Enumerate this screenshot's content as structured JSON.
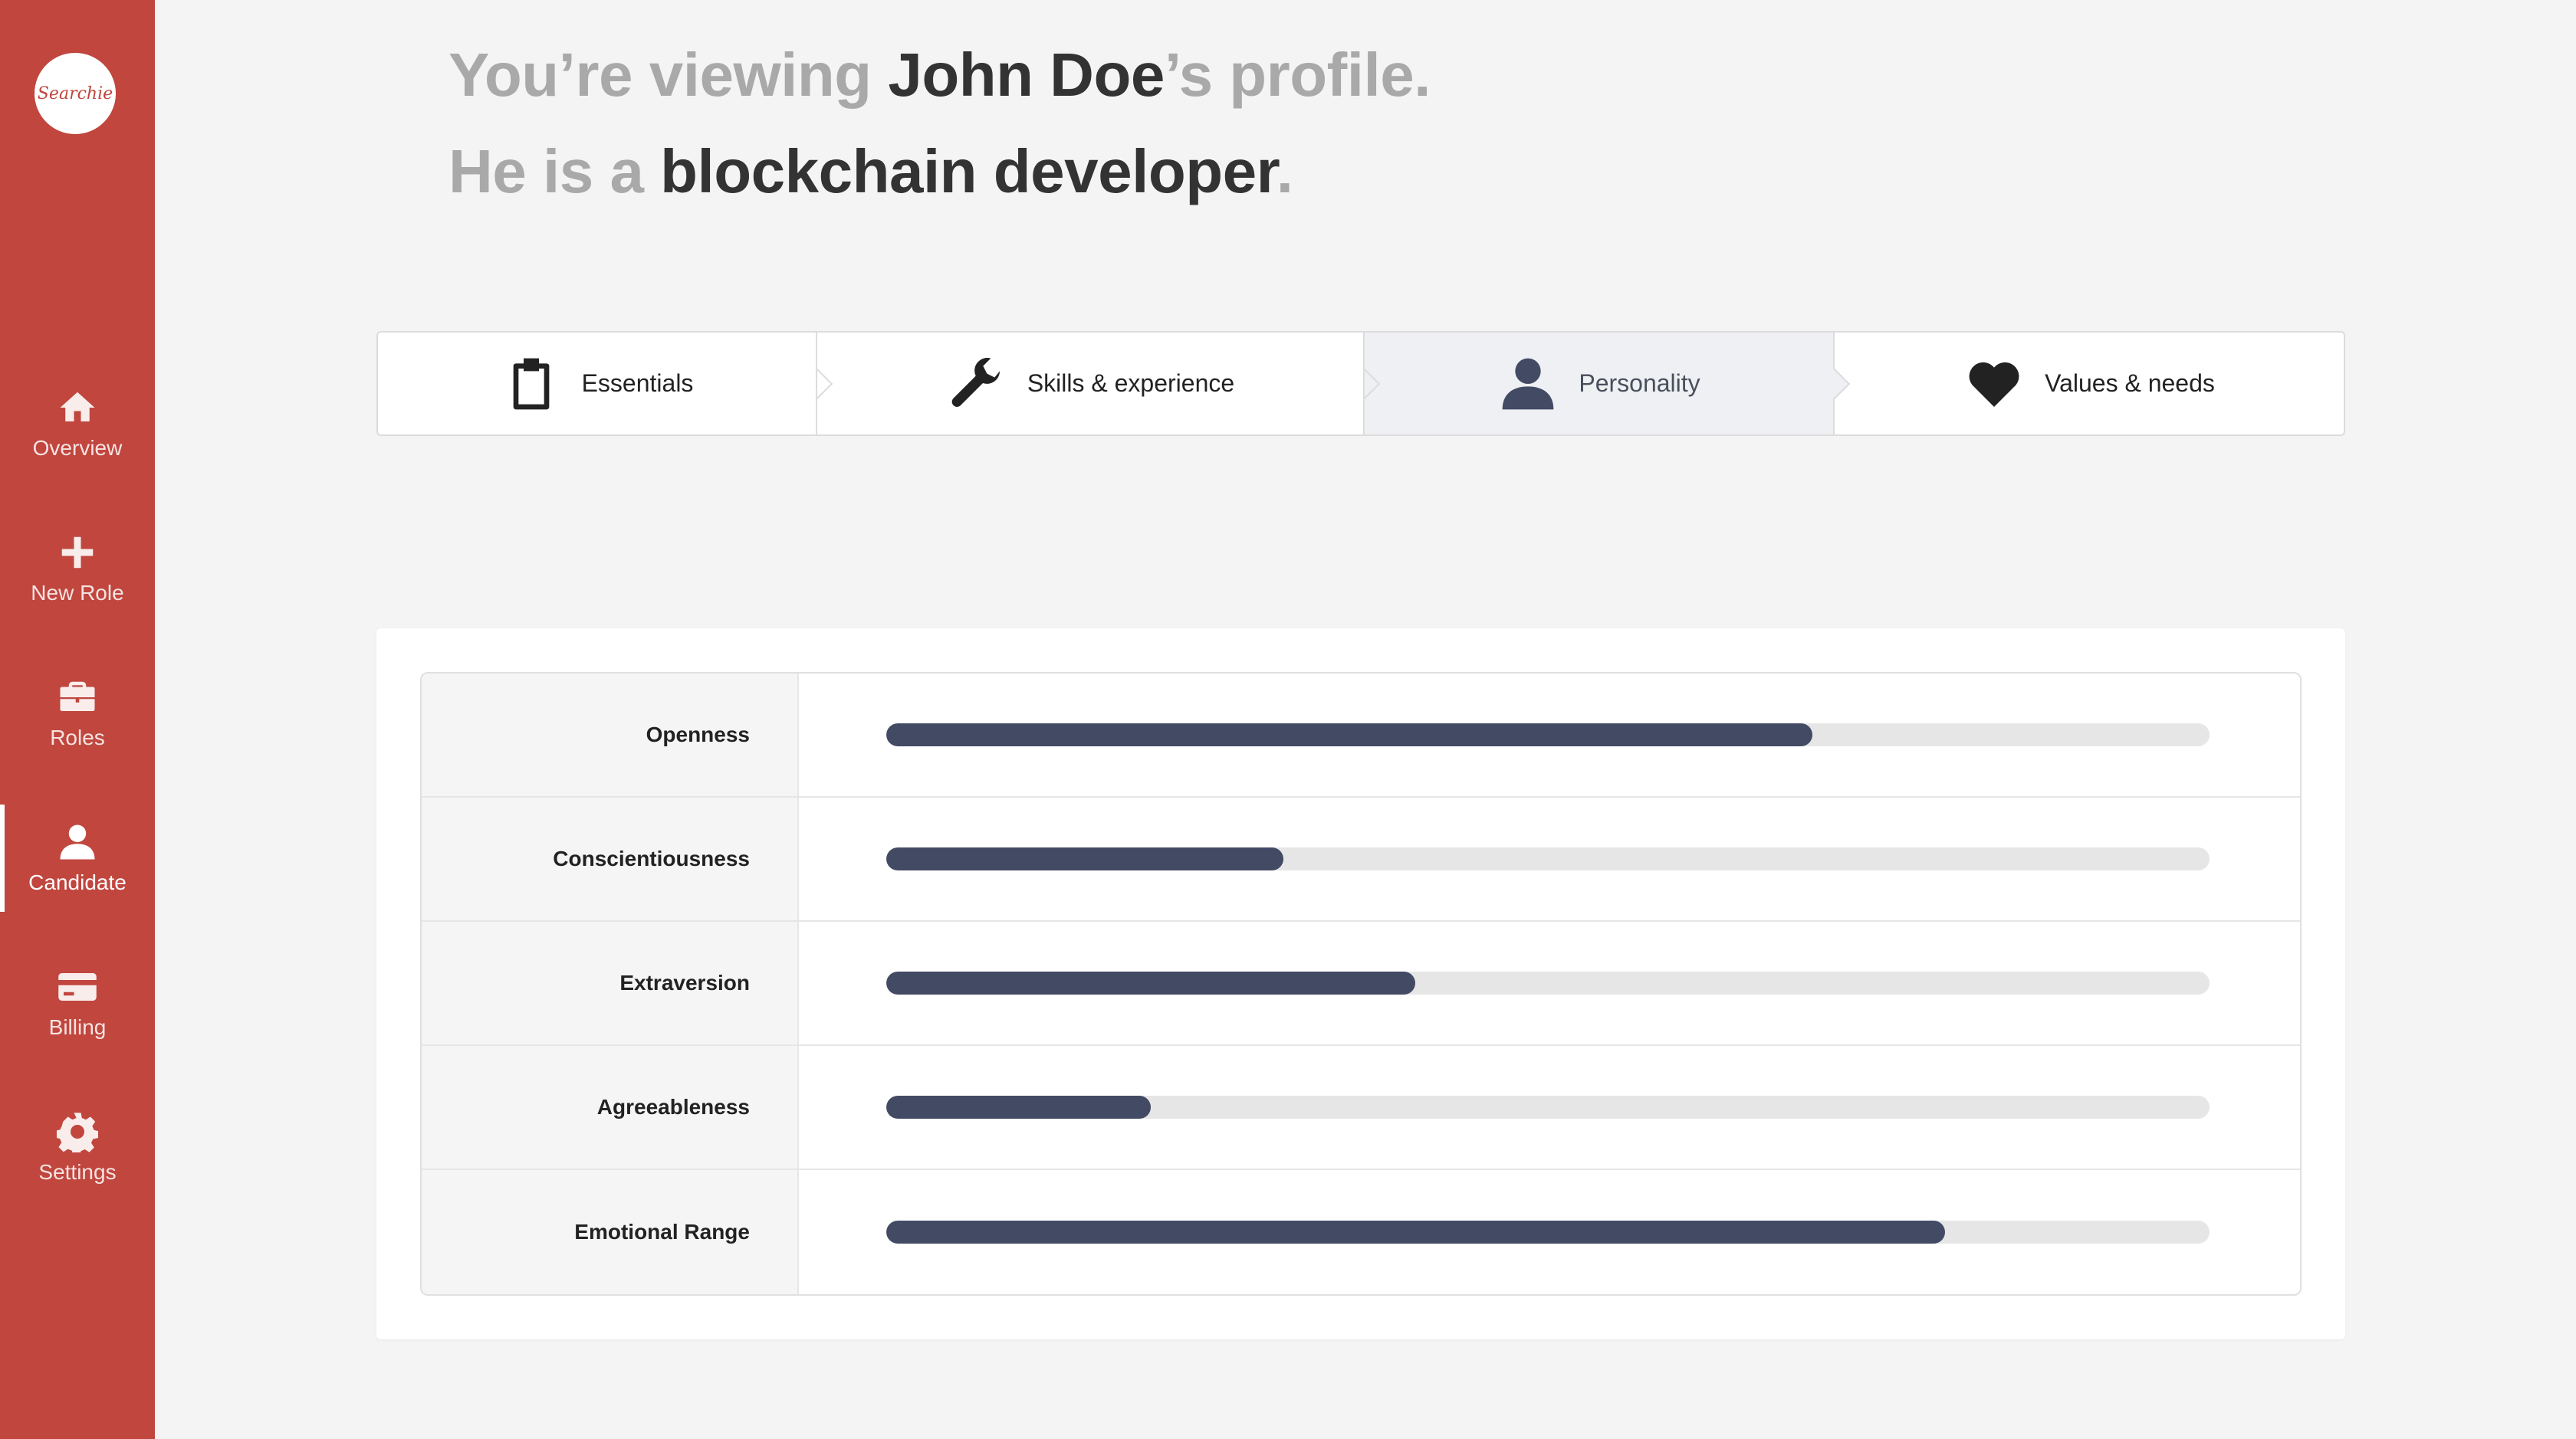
{
  "app": {
    "logo_text": "Searchie"
  },
  "sidebar": {
    "items": [
      {
        "label": "Overview",
        "icon": "home-icon"
      },
      {
        "label": "New Role",
        "icon": "plus-icon"
      },
      {
        "label": "Roles",
        "icon": "briefcase-icon"
      },
      {
        "label": "Candidate",
        "icon": "user-icon",
        "active": true
      },
      {
        "label": "Billing",
        "icon": "credit-card-icon"
      },
      {
        "label": "Settings",
        "icon": "gear-icon"
      }
    ]
  },
  "headline": {
    "line1_prefix": "You’re viewing ",
    "name": "John Doe",
    "line1_suffix": "’s profile.",
    "line2_prefix": "He is a ",
    "role": "blockchain developer",
    "line2_suffix": "."
  },
  "tabs": [
    {
      "label": "Essentials",
      "icon": "clipboard-icon"
    },
    {
      "label": "Skills & experience",
      "icon": "wrench-icon"
    },
    {
      "label": "Personality",
      "icon": "user-icon",
      "active": true
    },
    {
      "label": "Values & needs",
      "icon": "heart-icon"
    }
  ],
  "traits": [
    {
      "label": "Openness",
      "value": 0.7
    },
    {
      "label": "Conscientiousness",
      "value": 0.3
    },
    {
      "label": "Extraversion",
      "value": 0.4
    },
    {
      "label": "Agreeableness",
      "value": 0.2
    },
    {
      "label": "Emotional Range",
      "value": 0.8
    }
  ],
  "colors": {
    "sidebar": "#c0463e",
    "bar_fill": "#434a64",
    "bar_track": "#e6e6e6",
    "headline_muted": "#a9a9a9",
    "headline_strong": "#333333"
  }
}
